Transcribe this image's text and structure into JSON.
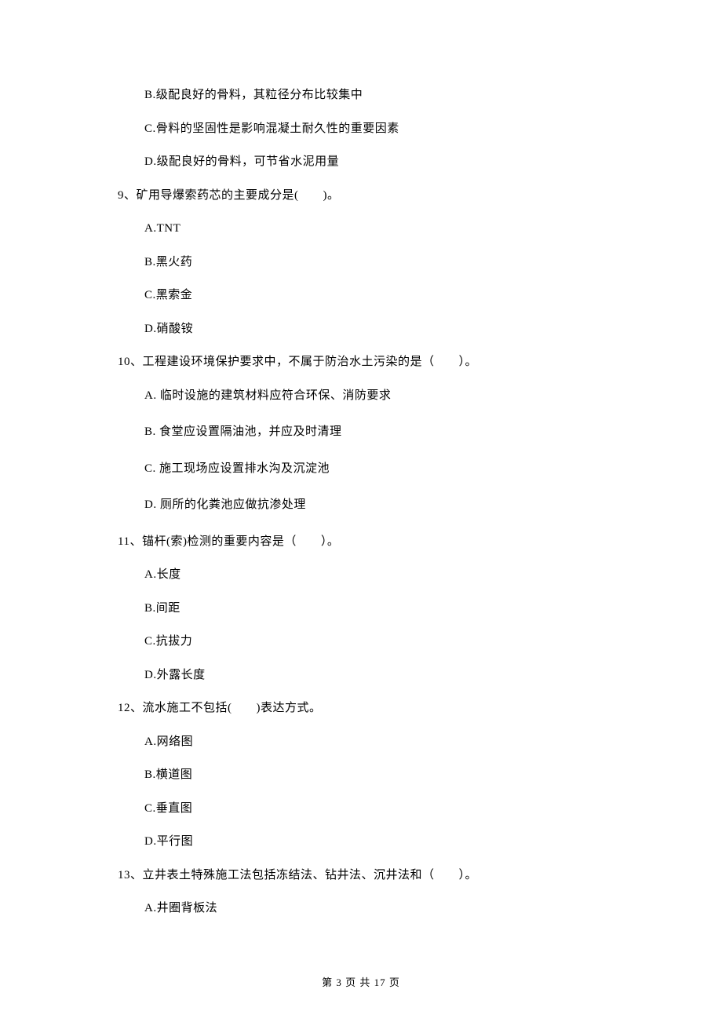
{
  "q8_options": {
    "b": "B.级配良好的骨料，其粒径分布比较集中",
    "c": "C.骨料的坚固性是影响混凝土耐久性的重要因素",
    "d": "D.级配良好的骨料，可节省水泥用量"
  },
  "q9": {
    "stem": "9、矿用导爆索药芯的主要成分是(　　)。",
    "a": "A.TNT",
    "b": "B.黑火药",
    "c": "C.黑索金",
    "d": "D.硝酸铵"
  },
  "q10": {
    "stem": "10、工程建设环境保护要求中，不属于防治水土污染的是（　　）。",
    "a": "A.  临时设施的建筑材料应符合环保、消防要求",
    "b": "B.  食堂应设置隔油池，并应及时清理",
    "c": "C.  施工现场应设置排水沟及沉淀池",
    "d": "D.  厕所的化粪池应做抗渗处理"
  },
  "q11": {
    "stem": "11、锚杆(索)检测的重要内容是（　　）。",
    "a": "A.长度",
    "b": "B.间距",
    "c": "C.抗拔力",
    "d": "D.外露长度"
  },
  "q12": {
    "stem": "12、流水施工不包括(　　)表达方式。",
    "a": "A.网络图",
    "b": "B.横道图",
    "c": "C.垂直图",
    "d": "D.平行图"
  },
  "q13": {
    "stem": "13、立井表土特殊施工法包括冻结法、钻井法、沉井法和（　　）。",
    "a": "A.井圈背板法"
  },
  "footer": "第 3 页 共 17 页"
}
